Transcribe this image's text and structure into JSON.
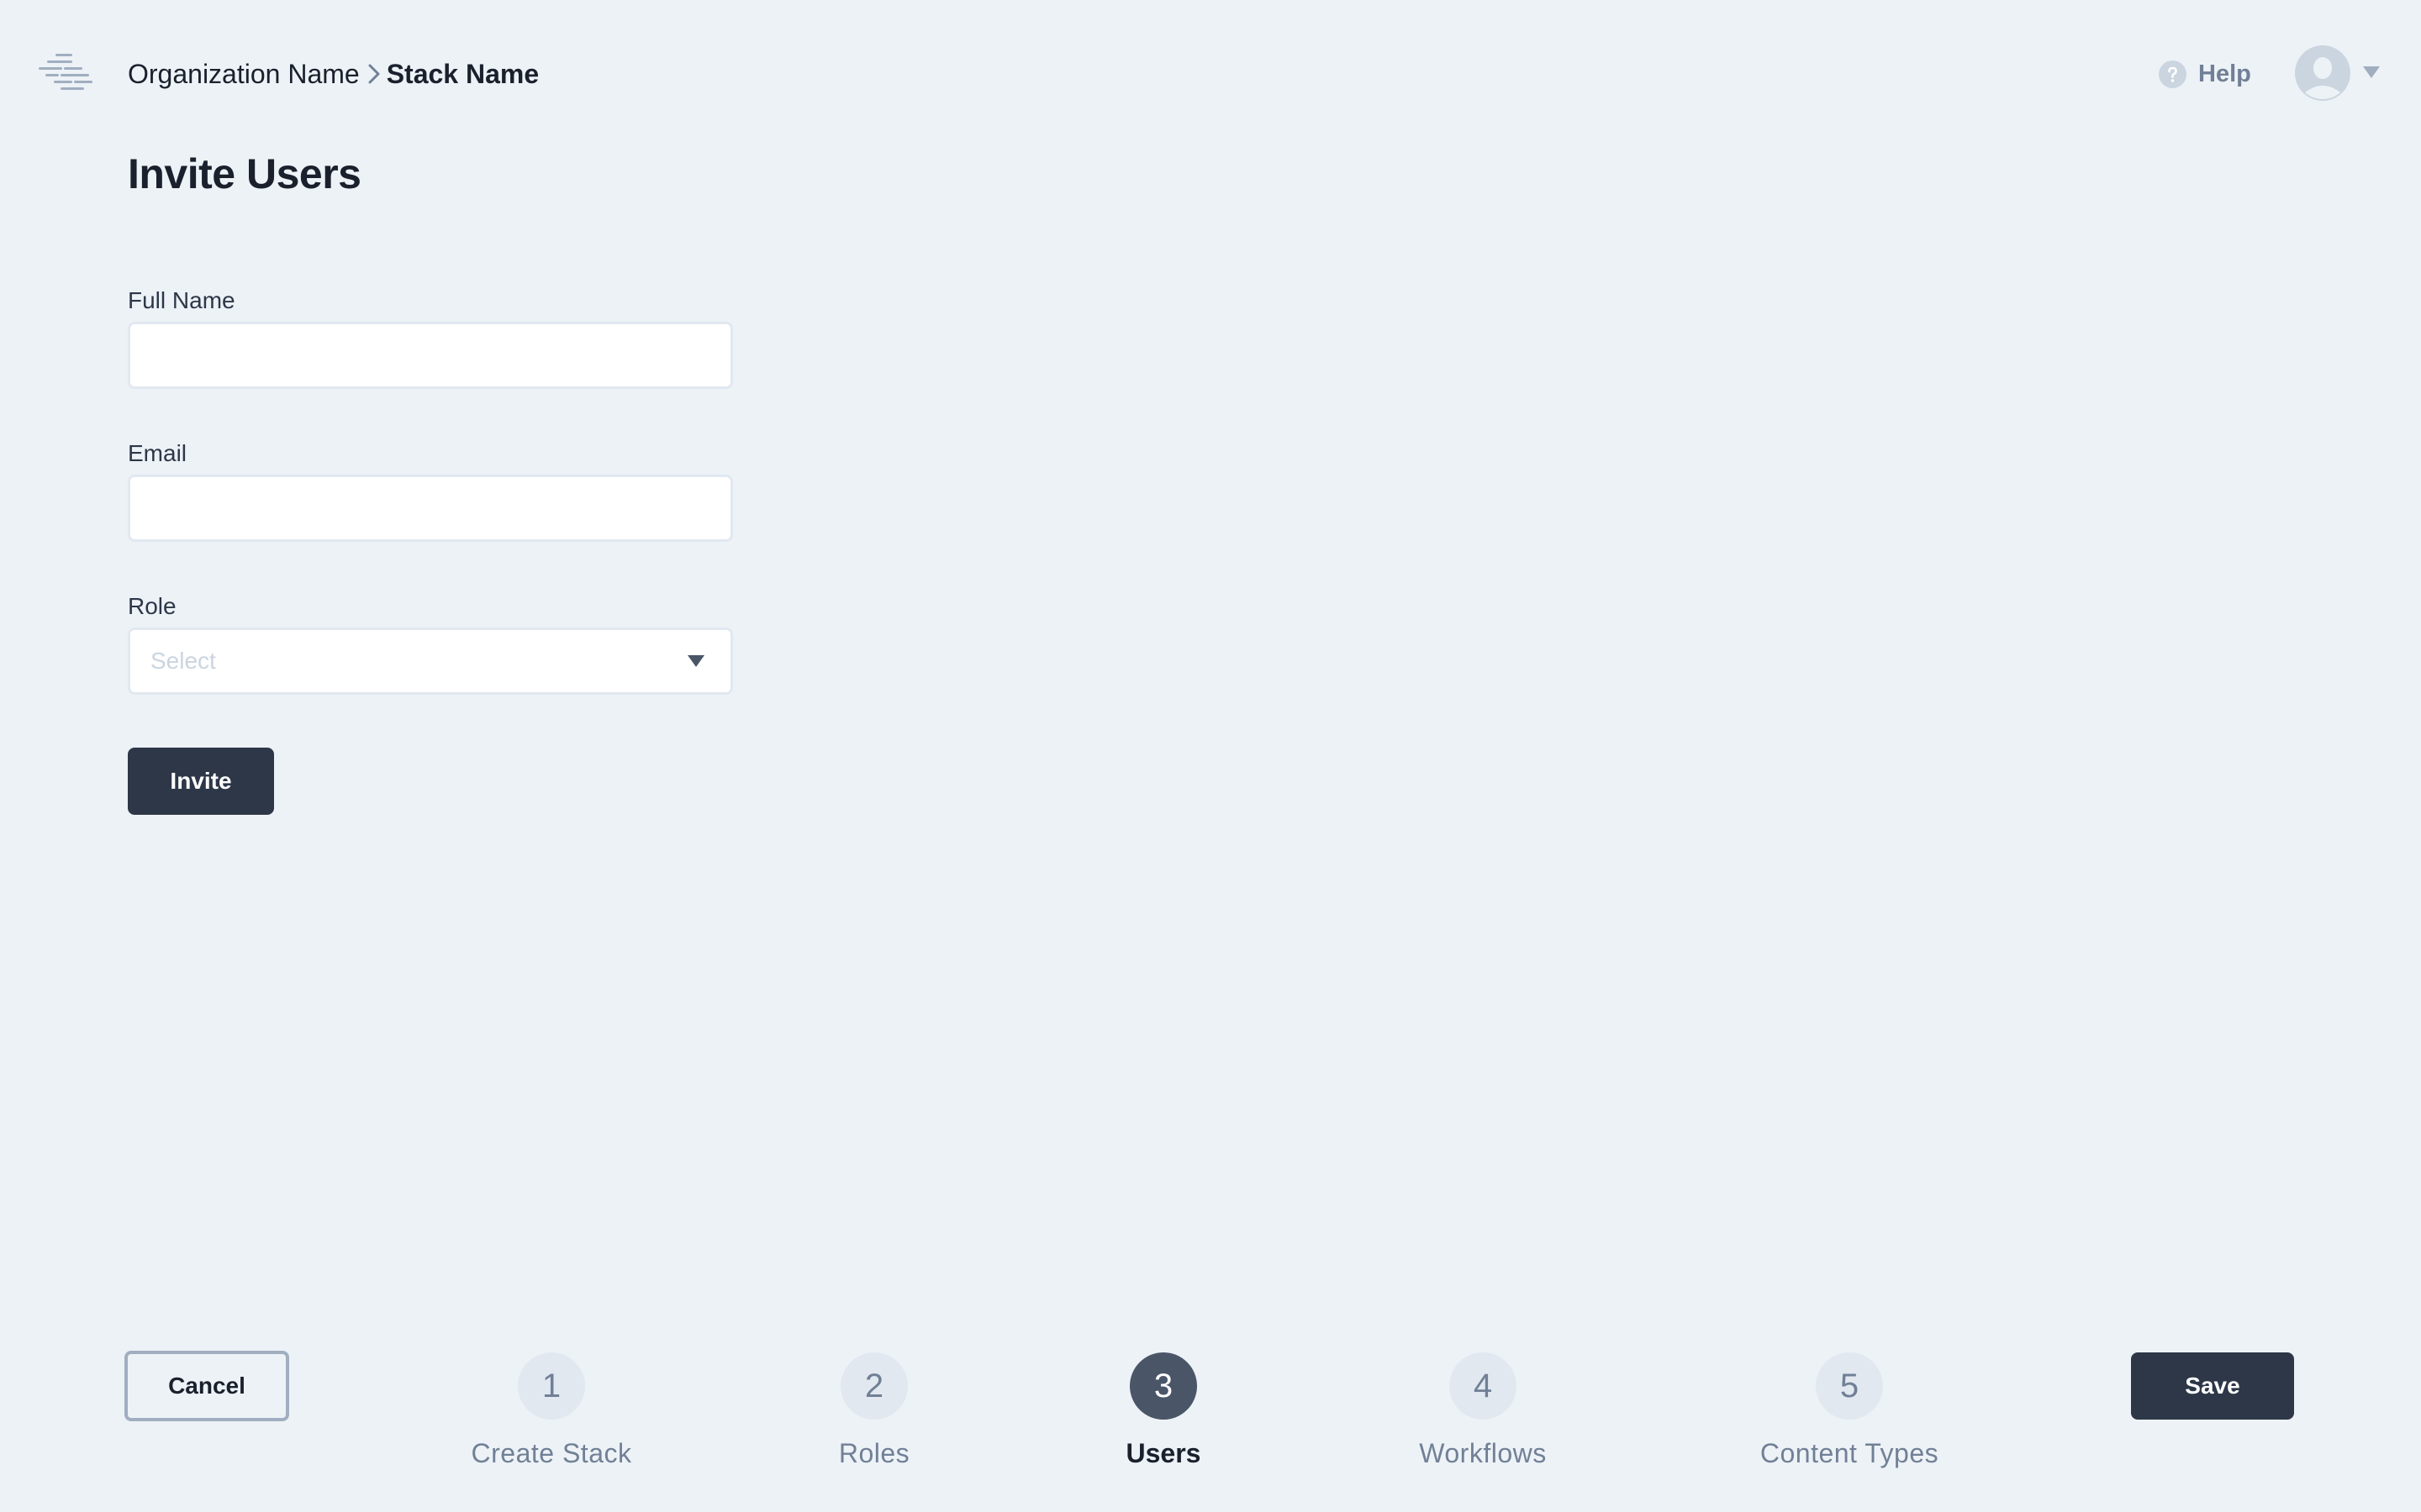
{
  "header": {
    "breadcrumb": {
      "organization": "Organization Name",
      "stack": "Stack Name"
    },
    "help_label": "Help",
    "icons": {
      "logo": "stacked-lines-logo",
      "breadcrumb_separator": "chevron-right-icon",
      "help": "question-circle-icon",
      "avatar": "user-avatar-icon",
      "avatar_menu": "caret-down-icon"
    }
  },
  "page": {
    "title": "Invite Users"
  },
  "form": {
    "full_name": {
      "label": "Full Name",
      "value": "",
      "placeholder": ""
    },
    "email": {
      "label": "Email",
      "value": "",
      "placeholder": ""
    },
    "role": {
      "label": "Role",
      "selected": "Select"
    },
    "invite_label": "Invite"
  },
  "footer": {
    "cancel_label": "Cancel",
    "save_label": "Save",
    "current_step": 3,
    "steps": [
      {
        "number": "1",
        "label": "Create Stack"
      },
      {
        "number": "2",
        "label": "Roles"
      },
      {
        "number": "3",
        "label": "Users"
      },
      {
        "number": "4",
        "label": "Workflows"
      },
      {
        "number": "5",
        "label": "Content Types"
      }
    ]
  },
  "colors": {
    "background": "#edf2f7",
    "primary_button": "#2d3748",
    "active_step": "#4a5568",
    "inactive_step": "#e2e8f0",
    "muted_text": "#718096"
  }
}
